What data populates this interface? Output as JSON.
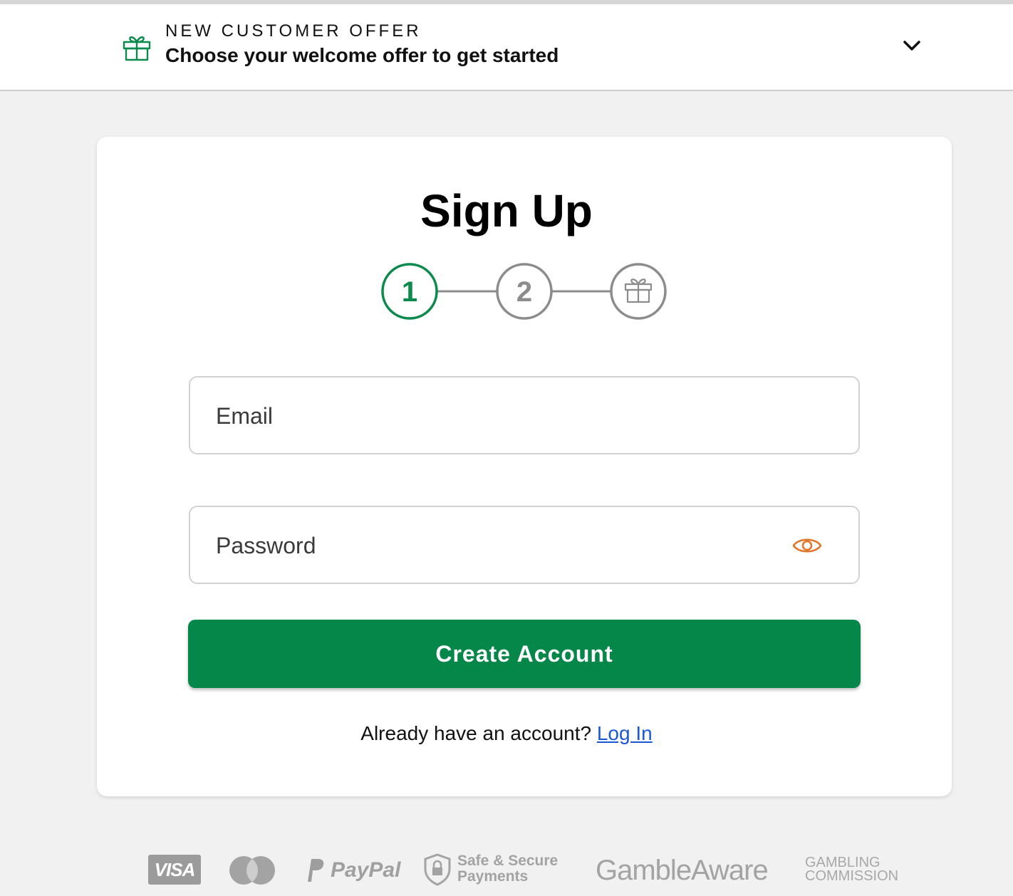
{
  "banner": {
    "kicker": "NEW CUSTOMER OFFER",
    "title": "Choose your welcome offer to get started",
    "icon": "gift-icon",
    "expand_icon": "chevron-down-icon",
    "accent": "#0a8a4b"
  },
  "signup": {
    "title": "Sign Up",
    "steps": [
      {
        "label": "1",
        "state": "active"
      },
      {
        "label": "2",
        "state": "inactive"
      },
      {
        "label": "",
        "icon": "gift-icon",
        "state": "inactive"
      }
    ],
    "email_placeholder": "Email",
    "password_placeholder": "Password",
    "password_toggle_icon": "eye-icon",
    "submit_label": "Create Account",
    "login_prompt": "Already have an account?",
    "login_link": "Log In"
  },
  "footer": {
    "logos": [
      {
        "name": "visa",
        "text": "VISA"
      },
      {
        "name": "mastercard",
        "text": ""
      },
      {
        "name": "paypal",
        "text": "PayPal"
      },
      {
        "name": "safe-secure",
        "text_line1": "Safe & Secure",
        "text_line2": "Payments"
      },
      {
        "name": "gambleaware",
        "text": "GambleAware"
      },
      {
        "name": "gambling-commission",
        "text_line1": "GAMBLING",
        "text_line2": "COMMISSION"
      }
    ]
  },
  "colors": {
    "primary": "#06874a",
    "link": "#1a57d6",
    "eye": "#e0772a",
    "background": "#f1f1f1"
  }
}
